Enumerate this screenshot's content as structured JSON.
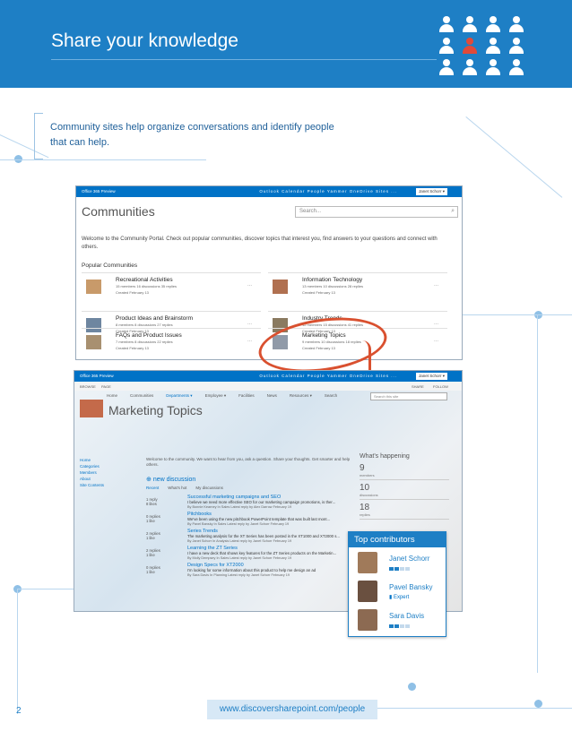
{
  "header": {
    "title": "Share your knowledge"
  },
  "intro": "Community sites help organize conversations and identify people that can help.",
  "shot1": {
    "bar_logo": "Office 365 Preview",
    "bar_nav": "Outlook  Calendar  People  Yammer  OneDrive  Sites  ...",
    "bar_user": "Janet Schorr ▾",
    "title": "Communities",
    "search_placeholder": "Search...",
    "welcome": "Welcome to the Community Portal. Check out popular communities, discover topics that interest you, find answers to your questions and connect with others.",
    "popular": "Popular Communities",
    "communities": [
      {
        "name": "Recreational Activities",
        "stats": "15 members  16 discussions  35 replies",
        "created": "Created February 13"
      },
      {
        "name": "Information Technology",
        "stats": "13 members  10 discussions  28 replies",
        "created": "Created February 13"
      },
      {
        "name": "Product Ideas and Brainstorm",
        "stats": "8 members  8 discussions  27 replies",
        "created": "Created February 13"
      },
      {
        "name": "Industry Trends",
        "stats": "12 members  15 discussions  41 replies",
        "created": "Created February 13"
      },
      {
        "name": "FAQs and Product Issues",
        "stats": "7 members  8 discussions  22 replies",
        "created": "Created February 13"
      },
      {
        "name": "Marketing Topics",
        "stats": "9 members  10 discussions  18 replies",
        "created": "Created February 13"
      }
    ],
    "more": "..."
  },
  "shot2": {
    "bar_logo": "Office 365 Preview",
    "bar_nav": "Outlook  Calendar  People  Yammer  OneDrive  Sites  ...",
    "bar_user": "Janet Schorr ▾",
    "browse": "BROWSE",
    "page": "PAGE",
    "share": "SHARE",
    "follow": "FOLLOW",
    "nav": [
      "Home",
      "Communities",
      "Departments ▾",
      "Employee ▾",
      "Facilities",
      "News",
      "Resources ▾",
      "Search"
    ],
    "title": "Marketing Topics",
    "search_placeholder": "Search this site",
    "left_nav": [
      "Home",
      "Categories",
      "Members",
      "About",
      "Site Contents"
    ],
    "welcome": "Welcome to the community. We want to hear from you, ask a question. Share your thoughts. Get smarter and help others.",
    "new_discussion": "new discussion",
    "tabs": [
      "Recent",
      "What's hot",
      "My discussions"
    ],
    "posts": [
      {
        "counts": "1 reply\n8 likes",
        "title": "Successful marketing campaigns and SEO",
        "text": "I believe we need more effective SEO for our marketing campaign promotions, is ther...",
        "meta": "By Bonnie Kearney  In Sales  Latest reply by Alex Darrow  February 19"
      },
      {
        "counts": "0 replies\n1 like",
        "title": "Pitchbooks",
        "text": "We've been using the new pitchbook PowerPoint template that was built last mont...",
        "meta": "By Pavel Bansky  In Sales  Latest reply by Janet Schorr  February 19"
      },
      {
        "counts": "2 replies\n1 like",
        "title": "Series Trends",
        "text": "The marketing analysis for the XT Series has been posted in the XT1000 and XT2000 s...",
        "meta": "By Janet Schorr  In Analysis  Latest reply by Janet Schorr  February 19"
      },
      {
        "counts": "2 replies\n1 like",
        "title": "Learning the ZT Series",
        "text": "I have a new deck that shows key features for the ZT Series products on the Marketin...",
        "meta": "By Molly Dempsey  In Sales  Latest reply by Janet Schorr  February 19"
      },
      {
        "counts": "0 replies\n1 like",
        "title": "Design Specs for XT2000",
        "text": "I'm looking for some information about this product to help me design an ad",
        "meta": "By Sara Davis  In Planning  Latest reply by Janet Schorr  February 19"
      }
    ],
    "whats": {
      "title": "What's happening",
      "members": "9",
      "members_l": "members",
      "disc": "10",
      "disc_l": "discussions",
      "rep": "18",
      "rep_l": "replies"
    }
  },
  "contributors": {
    "title": "Top contributors",
    "people": [
      {
        "name": "Janet Schorr",
        "badge": ""
      },
      {
        "name": "Pavel Bansky",
        "badge": "Expert"
      },
      {
        "name": "Sara Davis",
        "badge": ""
      }
    ]
  },
  "footer": {
    "page": "2",
    "url": "www.discoversharepoint.com/people"
  },
  "colors": {
    "brand": "#1e7fc5",
    "highlight": "#d9502f"
  }
}
